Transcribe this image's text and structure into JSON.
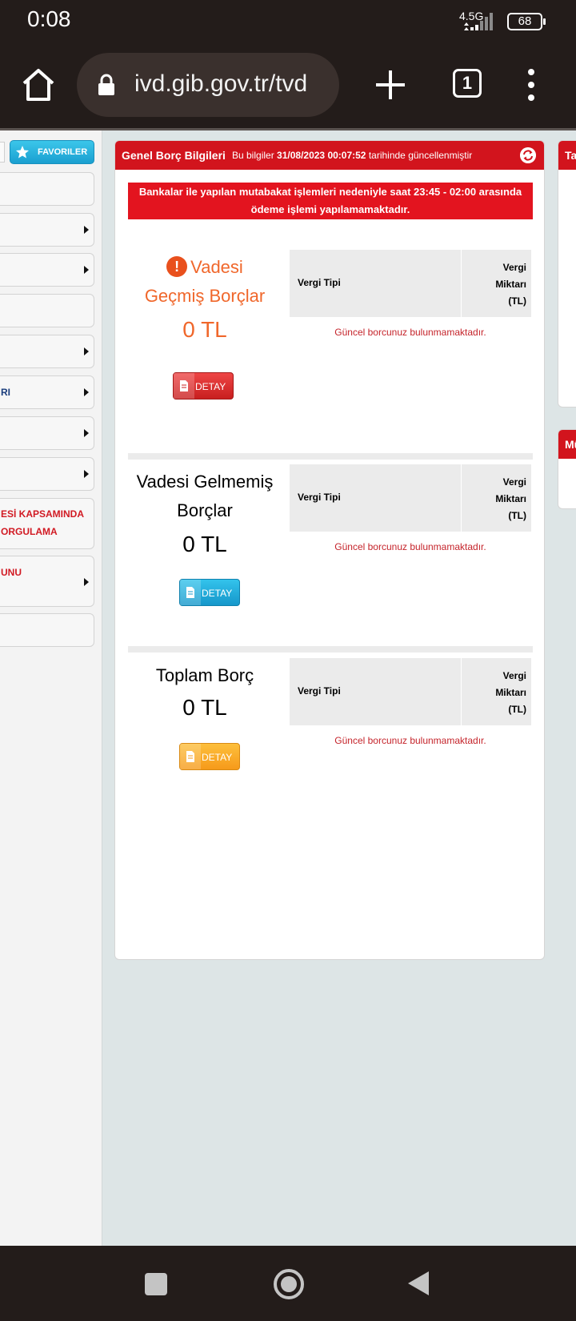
{
  "status_bar": {
    "time": "0:08",
    "network": "4.5G",
    "battery": "68"
  },
  "browser": {
    "url": "ivd.gib.gov.tr/tvd",
    "tab_count": "1"
  },
  "sidebar": {
    "favorites_label": "FAVORILER",
    "items": [
      {
        "text_line1": "",
        "text_line2": "",
        "has_arrow": false
      },
      {
        "text_line1": "",
        "text_line2": "",
        "has_arrow": true
      },
      {
        "text_line1": "",
        "text_line2": "",
        "has_arrow": true
      },
      {
        "text_line1": "",
        "text_line2": "",
        "has_arrow": false
      },
      {
        "text_line1": "",
        "text_line2": "",
        "has_arrow": true
      },
      {
        "text_line1": "RI",
        "text_line2": "",
        "has_arrow": true
      },
      {
        "text_line1": "",
        "text_line2": "",
        "has_arrow": true
      },
      {
        "text_line1": "",
        "text_line2": "",
        "has_arrow": true
      },
      {
        "text_line1": "ESİ KAPSAMINDA",
        "text_line2": "ORGULAMA",
        "has_arrow": false
      },
      {
        "text_line1": "UNU",
        "text_line2": "",
        "has_arrow": true
      },
      {
        "text_line1": "",
        "text_line2": "",
        "has_arrow": false
      }
    ]
  },
  "panel": {
    "title": "Genel Borç Bilgileri",
    "info_prefix": "Bu bilgiler",
    "info_datetime": "31/08/2023 00:07:52",
    "info_suffix": "tarihinde güncellenmiştir",
    "notice_line1": "Bankalar ile yapılan mutabakat işlemleri nedeniyle saat 23:45 - 02:00 arasında",
    "notice_line2": "ödeme işlemi yapılamamaktadır.",
    "sections": [
      {
        "title_line1": "Vadesi",
        "title_line2": "Geçmiş Borçlar",
        "amount": "0 TL",
        "button": "DETAY",
        "col_type": "Vergi Tipi",
        "col_amount_1": "Vergi",
        "col_amount_2": "Miktarı",
        "col_amount_3": "(TL)",
        "empty": "Güncel borcunuz bulunmamaktadır."
      },
      {
        "title_line1": "Vadesi Gelmemiş",
        "title_line2": "Borçlar",
        "amount": "0 TL",
        "button": "DETAY",
        "col_type": "Vergi Tipi",
        "col_amount_1": "Vergi",
        "col_amount_2": "Miktarı",
        "col_amount_3": "(TL)",
        "empty": "Güncel borcunuz bulunmamaktadır."
      },
      {
        "title_line1": "Toplam Borç",
        "title_line2": "",
        "amount": "0 TL",
        "button": "DETAY",
        "col_type": "Vergi Tipi",
        "col_amount_1": "Vergi",
        "col_amount_2": "Miktarı",
        "col_amount_3": "(TL)",
        "empty": "Güncel borcunuz bulunmamaktadır."
      }
    ]
  },
  "right_panels": [
    {
      "title": "Ta"
    },
    {
      "title": "Mü"
    }
  ],
  "colors": {
    "header_red": "#d2141d",
    "alert_orange": "#f0672b",
    "empty_text_red": "#c5242b"
  }
}
